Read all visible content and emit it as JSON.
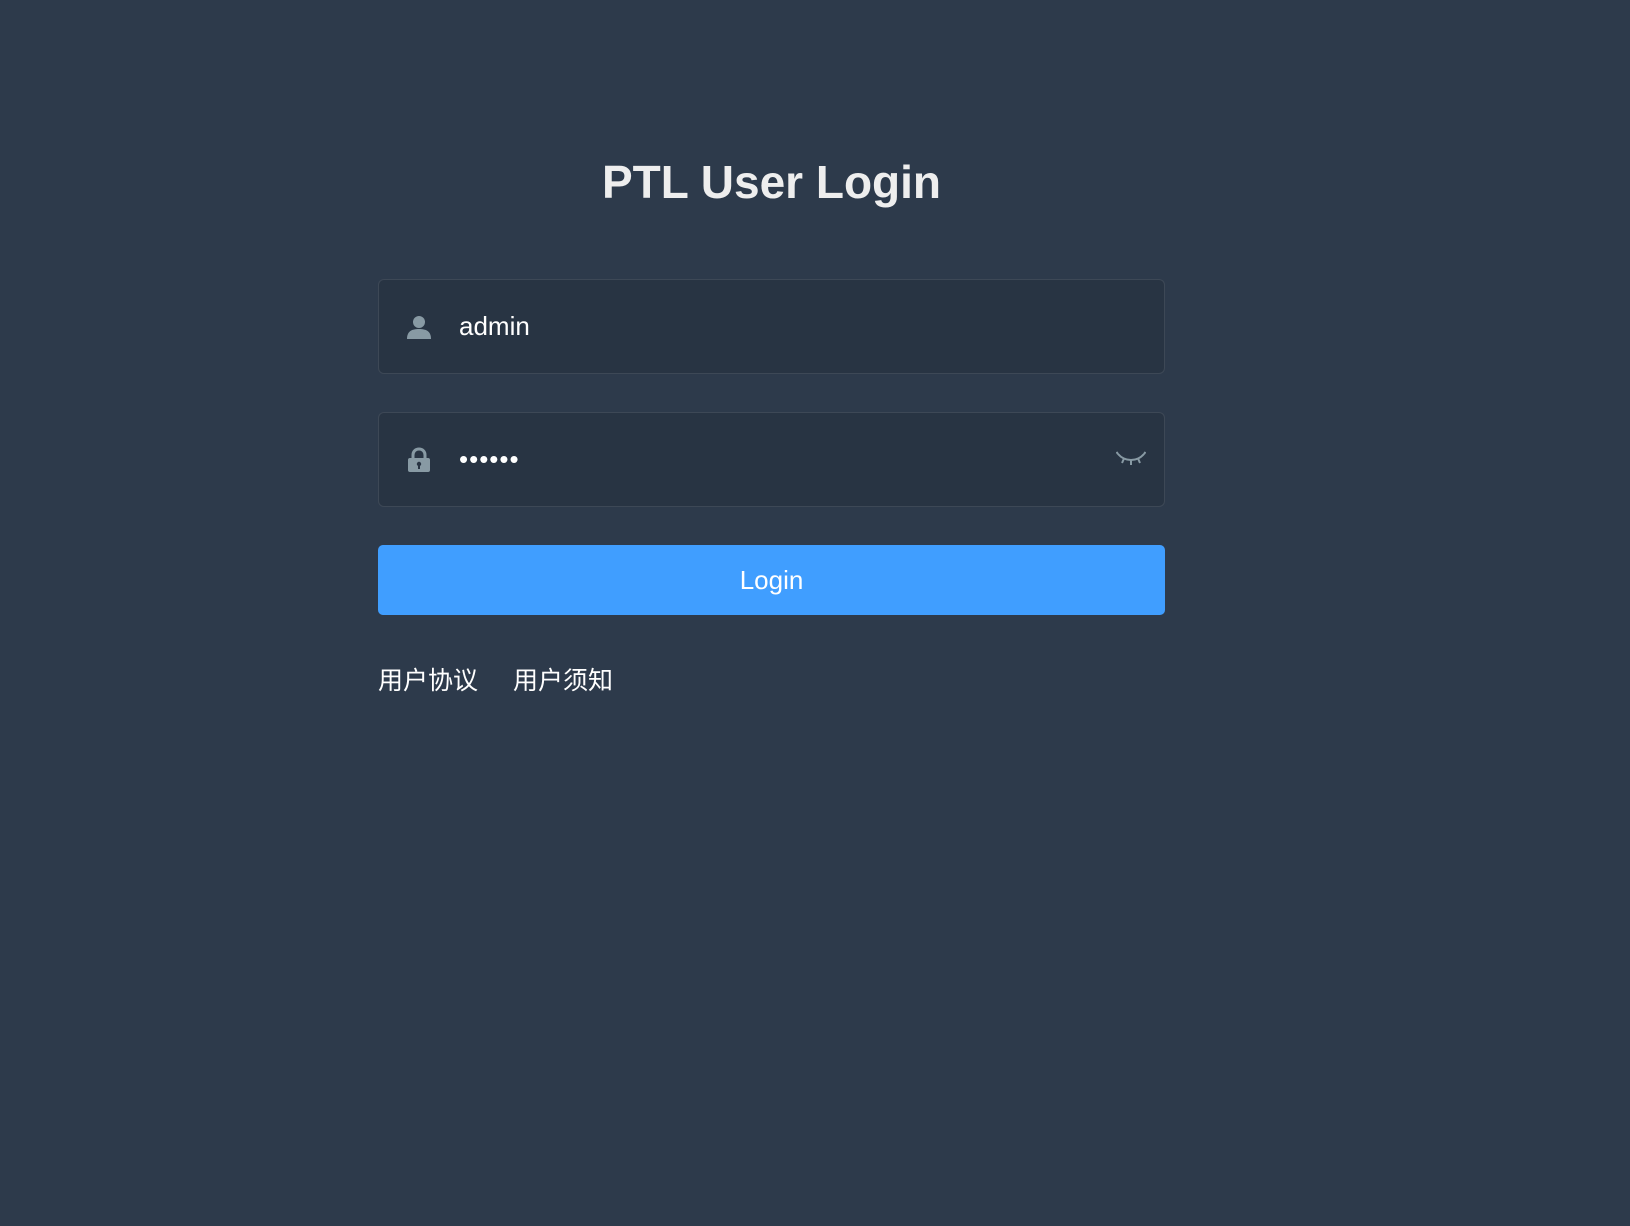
{
  "page": {
    "title": "PTL User Login"
  },
  "form": {
    "username": {
      "value": "admin",
      "icon": "user-icon"
    },
    "password": {
      "value": "••••••",
      "icon": "lock-icon",
      "toggle_icon": "eye-closed-icon"
    },
    "login_label": "Login"
  },
  "links": [
    {
      "label": "用户协议"
    },
    {
      "label": "用户须知"
    }
  ],
  "colors": {
    "background": "#2d3a4b",
    "field_background": "#283443",
    "button": "#409eff",
    "icon": "#889aa4",
    "title": "#eeeeee"
  }
}
